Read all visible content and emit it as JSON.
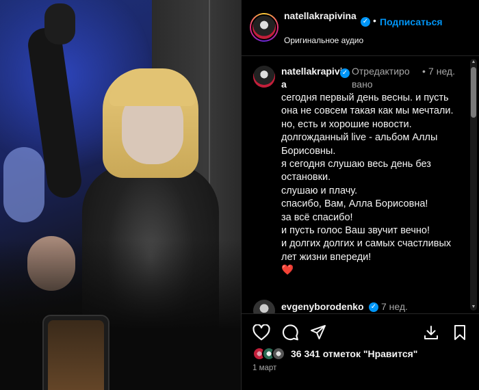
{
  "header": {
    "username": "natellakrapivina",
    "verified_mark": "✓",
    "dot": "•",
    "follow_label": "Подписаться",
    "audio_label": "Оригинальное аудио"
  },
  "caption": {
    "username": "natellakrapivina",
    "edited_label": "Отредактировано",
    "dot": "•",
    "time": "7 нед.",
    "lines": [
      "сегодня первый день весны. и пусть она не совсем такая как мы мечтали.",
      "но, есть и хорошие новости. долгожданный live - альбом Аллы Борисовны.",
      "я сегодня слушаю весь день без остановки.",
      "слушаю и плачу.",
      "спасибо, Вам, Алла Борисовна!",
      "за всё спасибо!",
      "и пусть голос Ваш звучит вечно!",
      "и долгих долгих и самых счастливых лет жизни впереди!"
    ],
    "emoji": "❤️"
  },
  "comment2": {
    "username": "evgenyborodenko",
    "time": "7 нед."
  },
  "actions": {
    "icons": [
      "heart-icon",
      "comment-icon",
      "share-icon",
      "download-icon",
      "bookmark-icon"
    ],
    "likes": "36 341 отметок \"Нравится\"",
    "date": "1 март"
  },
  "colors": {
    "accent": "#0095f6",
    "background": "#000000",
    "secondary_text": "#a8a8a8",
    "heart": "#e8352b"
  }
}
